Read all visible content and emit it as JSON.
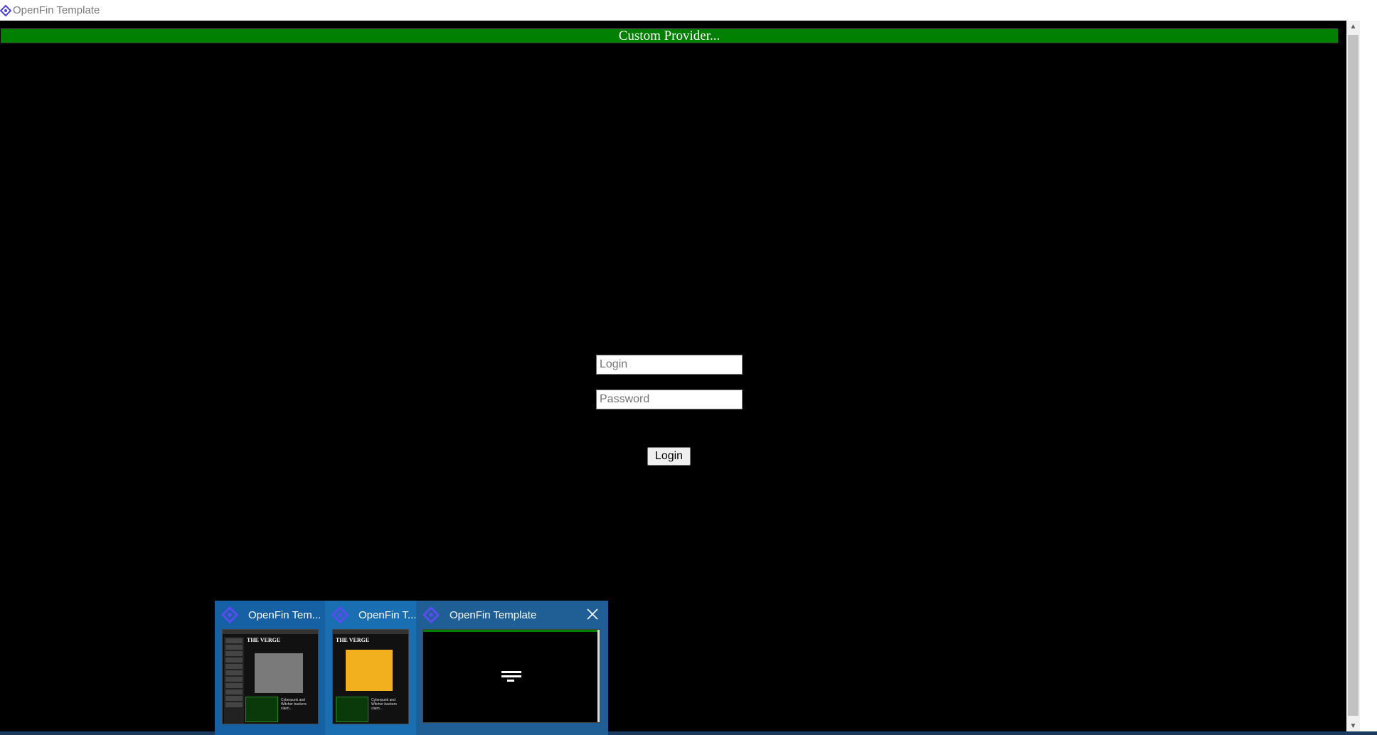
{
  "window": {
    "title": "OpenFin Template",
    "icon": "openfin-logo-icon"
  },
  "banner": {
    "text": "Custom Provider..."
  },
  "login_form": {
    "login_placeholder": "Login",
    "password_placeholder": "Password",
    "login_button_label": "Login"
  },
  "taskbar_previews": [
    {
      "label": "OpenFin Tem...",
      "icon": "openfin-logo-icon"
    },
    {
      "label": "OpenFin T...",
      "icon": "openfin-logo-icon"
    },
    {
      "label": "OpenFin Template",
      "icon": "openfin-logo-icon",
      "close_icon": "close-icon"
    }
  ],
  "colors": {
    "banner_bg": "#008000",
    "page_bg": "#000000",
    "openfin_accent": "#4b3fe0",
    "taskbar_preview_bg": "#1565a8"
  }
}
